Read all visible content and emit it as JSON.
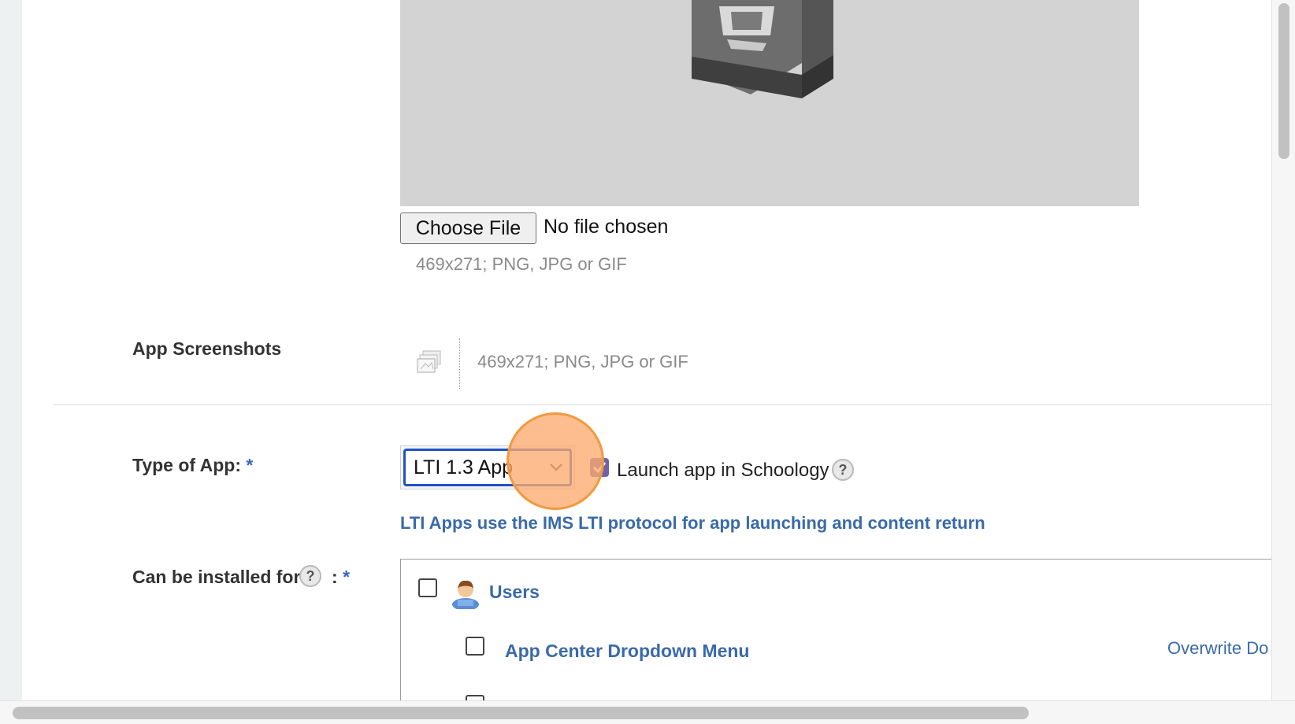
{
  "app_icon": {
    "choose_file_label": "Choose File",
    "file_status": "No file chosen",
    "hint": "469x271; PNG, JPG or GIF"
  },
  "app_screenshots": {
    "label": "App Screenshots",
    "hint": "469x271; PNG, JPG or GIF"
  },
  "type_of_app": {
    "label": "Type of App:",
    "required_mark": "*",
    "selected_value": "LTI 1.3 App",
    "launch_label": "Launch app in Schoology",
    "launch_checked": true,
    "help_glyph": "?",
    "note": "LTI Apps use the IMS LTI protocol for app launching and content return"
  },
  "installed_for": {
    "label": "Can be installed for",
    "help_glyph": "?",
    "colon": ":",
    "required_mark": "*",
    "items": [
      {
        "label": "Users",
        "icon": "user-icon"
      },
      {
        "label": "App Center Dropdown Menu",
        "link": "Overwrite Do"
      }
    ]
  },
  "colors": {
    "link": "#3a6aa8",
    "select_focus": "#1f51c9",
    "checkbox_checked": "#6f62a9",
    "cursor_highlight": "#f2993f",
    "preview_bg": "#d3d3d3"
  }
}
